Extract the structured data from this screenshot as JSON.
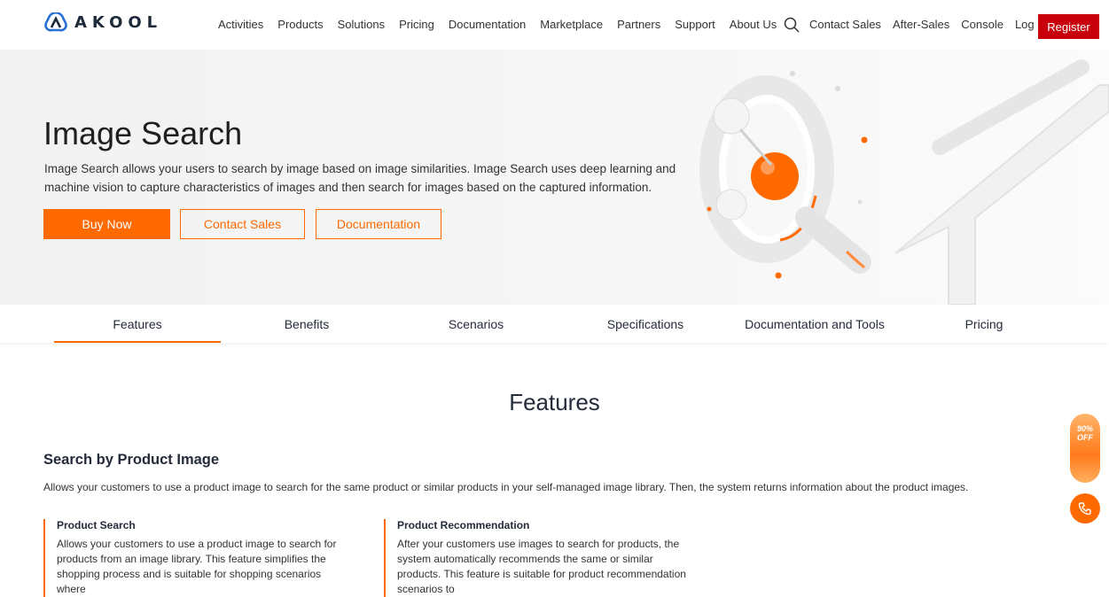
{
  "header": {
    "logo_text": "AKOOL",
    "nav": [
      "Activities",
      "Products",
      "Solutions",
      "Pricing",
      "Documentation",
      "Marketplace",
      "Partners",
      "Support",
      "About Us"
    ],
    "right_links": [
      "Contact Sales",
      "After-Sales",
      "Console",
      "Log In"
    ],
    "register_label": "Register"
  },
  "hero": {
    "title": "Image Search",
    "description": "Image Search allows your users to search by image based on image similarities. Image Search uses deep learning and machine vision to capture characteristics of images and then search for images based on the captured information.",
    "buttons": {
      "buy": "Buy Now",
      "contact": "Contact Sales",
      "documentation": "Documentation"
    }
  },
  "tabs": [
    "Features",
    "Benefits",
    "Scenarios",
    "Specifications",
    "Documentation and Tools",
    "Pricing"
  ],
  "active_tab": "Features",
  "features": {
    "title": "Features",
    "subtitle": "Search by Product Image",
    "subtitle_desc": "Allows your customers to use a product image to search for the same product or similar products in your self-managed image library. Then, the system returns information about the product images.",
    "cards": [
      {
        "title": "Product Search",
        "body": "Allows your customers to use a product image to search for products from an image library. This feature simplifies the shopping process and is suitable for shopping scenarios where"
      },
      {
        "title": "Product Recommendation",
        "body": "After your customers use images to search for products, the system automatically recommends the same or similar products. This feature is suitable for product recommendation scenarios to"
      }
    ]
  },
  "floating": {
    "promo_line1": "90%",
    "promo_line2": "OFF"
  },
  "colors": {
    "accent": "#ff6a00",
    "register": "#c7000b"
  },
  "icons": {
    "search": "search-icon",
    "phone": "phone-icon",
    "logo": "logo-icon"
  }
}
